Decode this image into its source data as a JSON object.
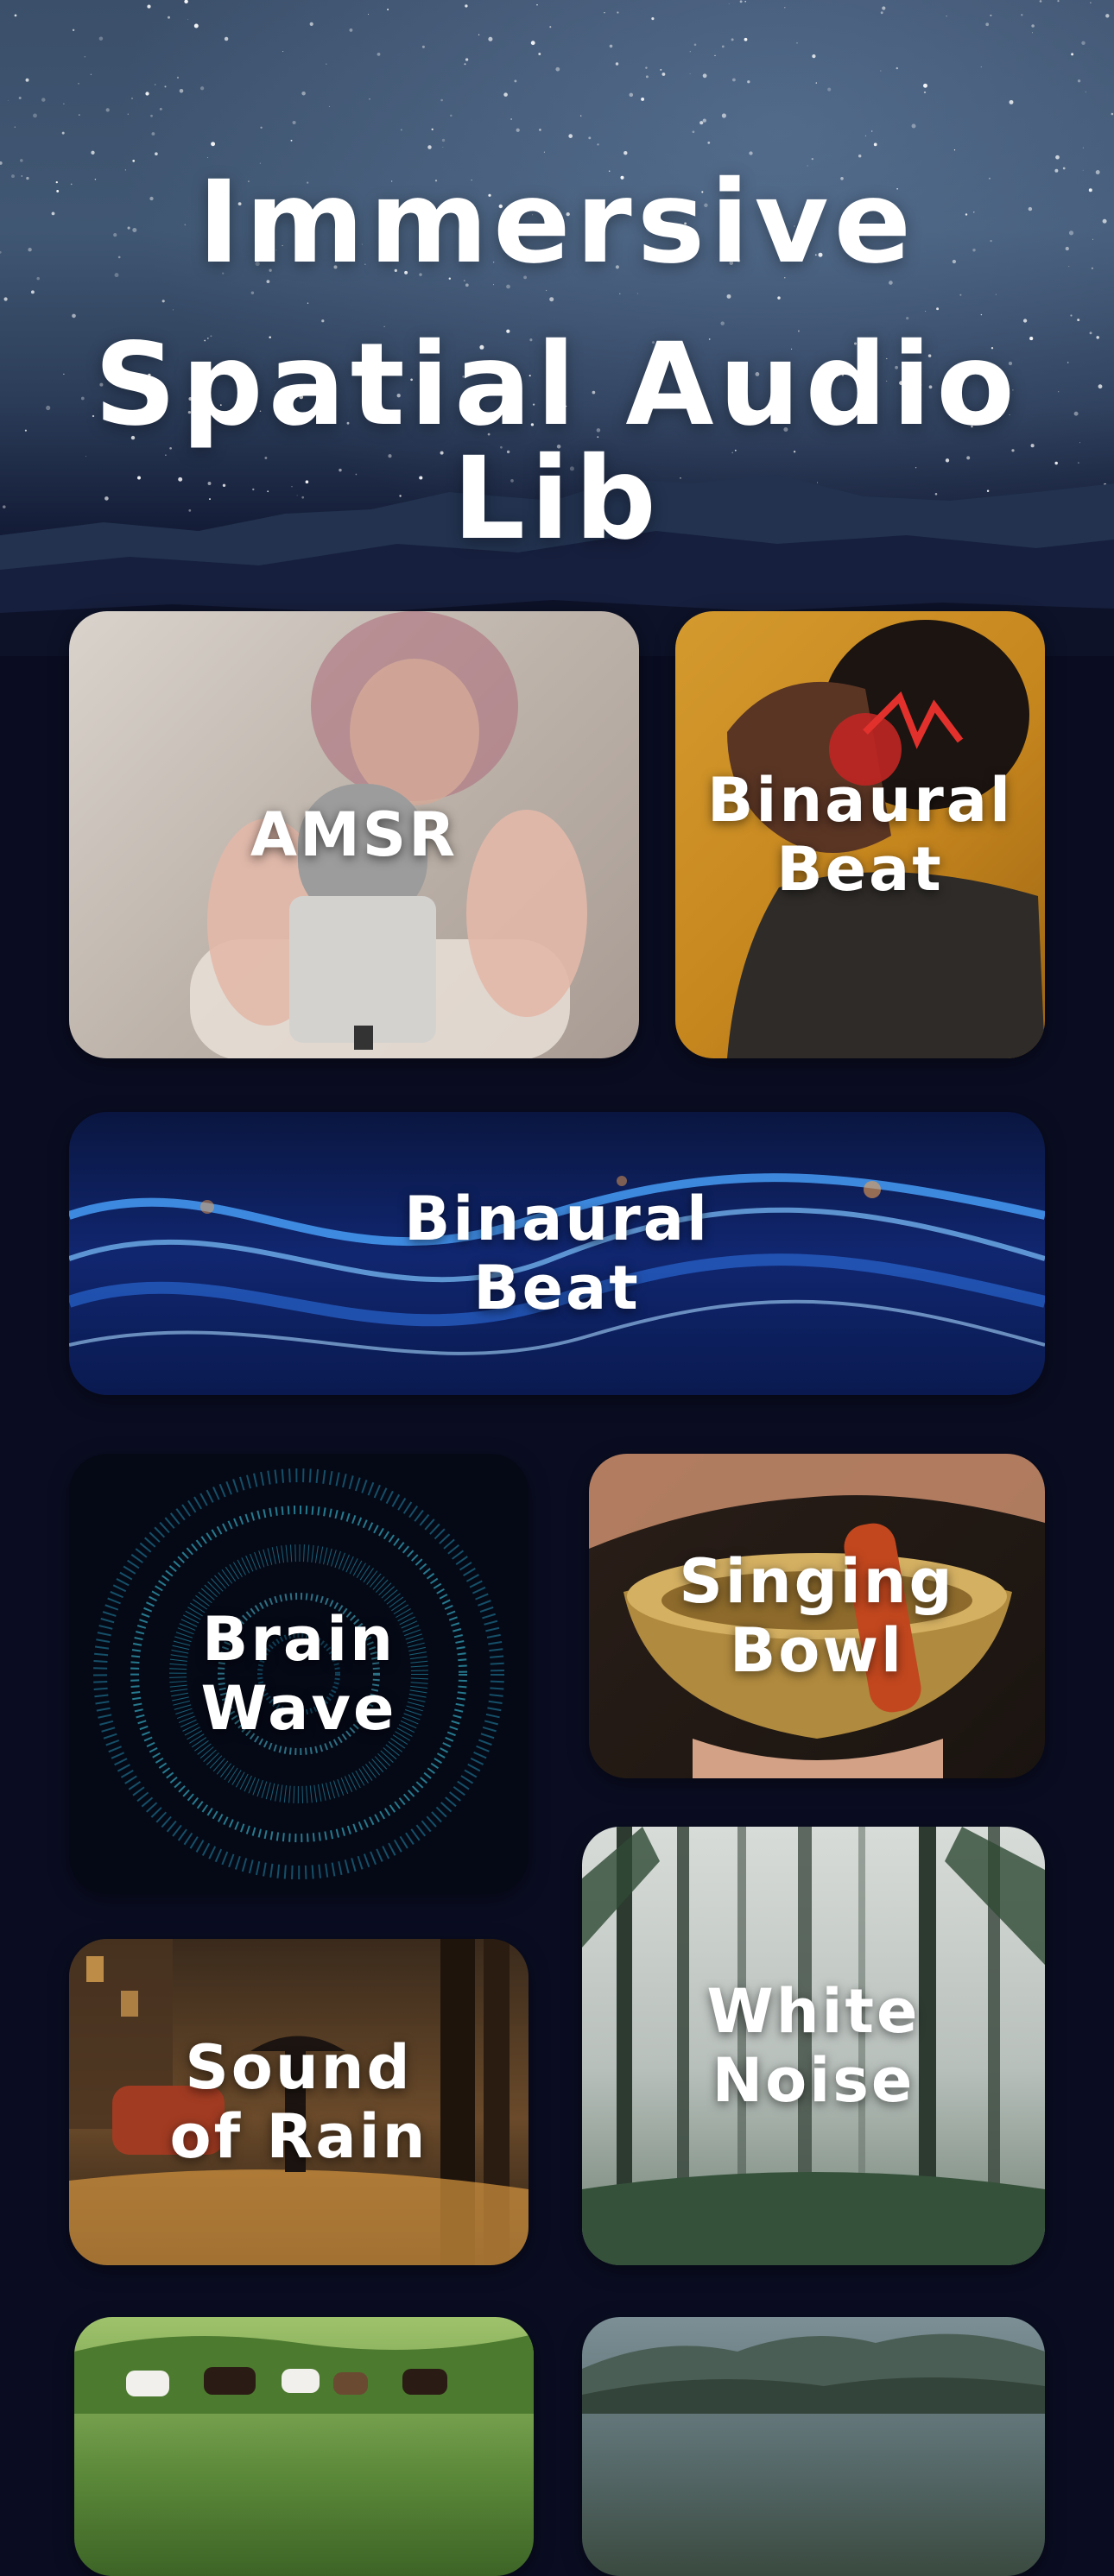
{
  "header": {
    "title_line1": "Immersive",
    "title_line2": "Spatial Audio Lib"
  },
  "cards": [
    {
      "label": "AMSR",
      "image": "person with microphone (blurred)"
    },
    {
      "label": "Binaural\nBeat",
      "image": "man in profile with red headphones"
    },
    {
      "label": "Binaural\nBeat",
      "image": "blue glowing waves"
    },
    {
      "label": "Brain\nWave",
      "image": "cyan particle sphere"
    },
    {
      "label": "Singing\nBowl",
      "image": "brass singing bowl with mallet"
    },
    {
      "label": "Sound\nof Rain",
      "image": "night street in rain with umbrella"
    },
    {
      "label": "White\nNoise",
      "image": "misty pine forest"
    },
    {
      "label": "",
      "image": "meadow with cattle"
    },
    {
      "label": "",
      "image": "misty hills"
    }
  ],
  "colors": {
    "background": "#0a0d22",
    "text": "#ffffff",
    "sky": "#3b4f6a"
  }
}
